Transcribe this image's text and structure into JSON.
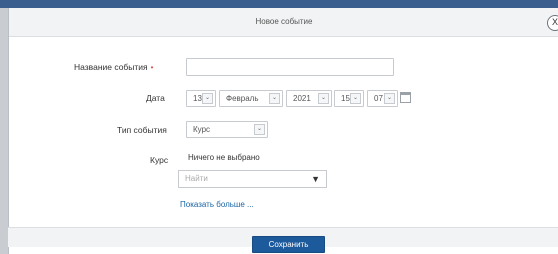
{
  "dialog": {
    "title": "Новое событие",
    "close_glyph": "X"
  },
  "form": {
    "event_name_label": "Название события",
    "required_marker": "•",
    "event_name_value": "",
    "date_label": "Дата",
    "date": {
      "day": "13",
      "month": "Февраль",
      "year": "2021",
      "hour": "15",
      "minute": "07"
    },
    "event_type_label": "Тип события",
    "event_type_value": "Курс",
    "course_label": "Курс",
    "course_selection_text": "Ничего не выбрано",
    "search_placeholder": "Найти",
    "show_more_link": "Показать больше ..."
  },
  "footer": {
    "save_label": "Сохранить"
  },
  "icons": {
    "dropdown_arrow": "chevron-down-icon",
    "calendar": "calendar-icon",
    "close": "close-icon"
  }
}
